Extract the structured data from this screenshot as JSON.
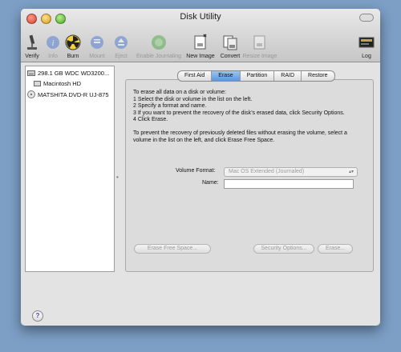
{
  "window": {
    "title": "Disk Utility"
  },
  "toolbar": {
    "items": [
      {
        "label": "Verify",
        "icon": "microscope-icon"
      },
      {
        "label": "Info",
        "icon": "info-icon"
      },
      {
        "label": "Burn",
        "icon": "radiation-icon"
      },
      {
        "label": "Mount",
        "icon": "mount-icon"
      },
      {
        "label": "Eject",
        "icon": "eject-icon"
      },
      {
        "label": "Enable Journaling",
        "icon": "journal-icon"
      },
      {
        "label": "New Image",
        "icon": "new-image-icon"
      },
      {
        "label": "Convert",
        "icon": "convert-icon"
      },
      {
        "label": "Resize Image",
        "icon": "resize-image-icon"
      },
      {
        "label": "Log",
        "icon": "log-icon"
      }
    ]
  },
  "sidebar": {
    "items": [
      {
        "label": "298.1 GB WDC WD3200...",
        "icon": "hard-disk-icon"
      },
      {
        "label": "Macintosh HD",
        "icon": "volume-icon"
      },
      {
        "label": "MATSHITA DVD-R UJ-875",
        "icon": "optical-drive-icon"
      }
    ]
  },
  "tabs": [
    "First Aid",
    "Erase",
    "Partition",
    "RAID",
    "Restore"
  ],
  "active_tab": "Erase",
  "instructions": {
    "line1": "To erase all data on a disk or volume:",
    "line2": "1 Select the disk or volume in the list on the left.",
    "line3": "2 Specify a format and name.",
    "line4": "3 If you want to prevent the recovery of the disk’s erased data, click Security Options.",
    "line5": "4 Click Erase.",
    "para2": "To prevent the recovery of previously deleted files without erasing the volume, select a volume in the list on the left, and click Erase Free Space."
  },
  "form": {
    "volume_format_label": "Volume Format:",
    "volume_format_value": "Mac OS Extended (Journaled)",
    "name_label": "Name:",
    "name_value": ""
  },
  "buttons": {
    "erase_free_space": "Erase Free Space...",
    "security_options": "Security Options...",
    "erase": "Erase..."
  },
  "help_glyph": "?",
  "colors": {
    "desktop": "#7d9fc6",
    "active_tab": "#5a97db"
  }
}
